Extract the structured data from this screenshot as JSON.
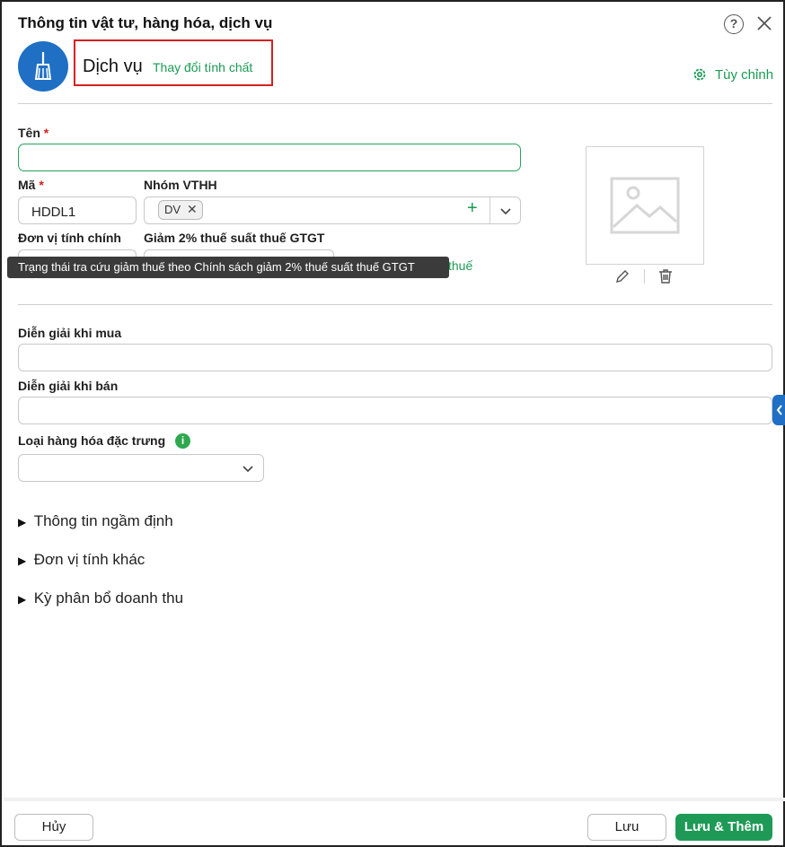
{
  "dialog": {
    "title": "Thông tin vật tư, hàng hóa, dịch vụ",
    "help_glyph": "?",
    "kind_label": "Dịch vụ",
    "change_kind_link": "Thay đổi tính chất",
    "customize_link": "Tùy chỉnh"
  },
  "form": {
    "name_label": "Tên",
    "required_mark": "*",
    "name_value": "",
    "code_label": "Mã",
    "code_value": "HDDL1",
    "group_label": "Nhóm VTHH",
    "group_chip": "DV",
    "chip_remove_glyph": "✕",
    "add_glyph": "+",
    "unit_label": "Đơn vị tính chính",
    "tax_reduction_label": "Giảm 2% thuế suất thuế GTGT",
    "tooltip": "Trạng thái tra cứu giảm thuế theo Chính sách giảm 2% thuế suất thuế GTGT",
    "tax_link_fragment": "thuế",
    "purchase_desc_label": "Diễn giải khi mua",
    "sale_desc_label": "Diễn giải khi bán",
    "special_goods_label": "Loại hàng hóa đặc trưng",
    "info_glyph": "i"
  },
  "sections": [
    {
      "label": "Thông tin ngầm định"
    },
    {
      "label": "Đơn vị tính khác"
    },
    {
      "label": "Kỳ phân bổ doanh thu"
    }
  ],
  "section_toggle_glyph": "▶",
  "footer": {
    "cancel": "Hủy",
    "save": "Lưu",
    "save_add": "Lưu & Thêm"
  },
  "colors": {
    "accent_green": "#1a9a54",
    "brand_blue": "#1f6fc5",
    "required_red": "#d62020"
  },
  "icons": {
    "avatar": "broom-icon",
    "help": "help-circle-icon",
    "close": "close-icon",
    "customize": "gear-icon",
    "image_placeholder": "image-placeholder-icon",
    "edit": "pencil-icon",
    "delete": "trash-icon",
    "dropdown": "chevron-down-icon",
    "side_tab": "chevron-left-icon"
  }
}
